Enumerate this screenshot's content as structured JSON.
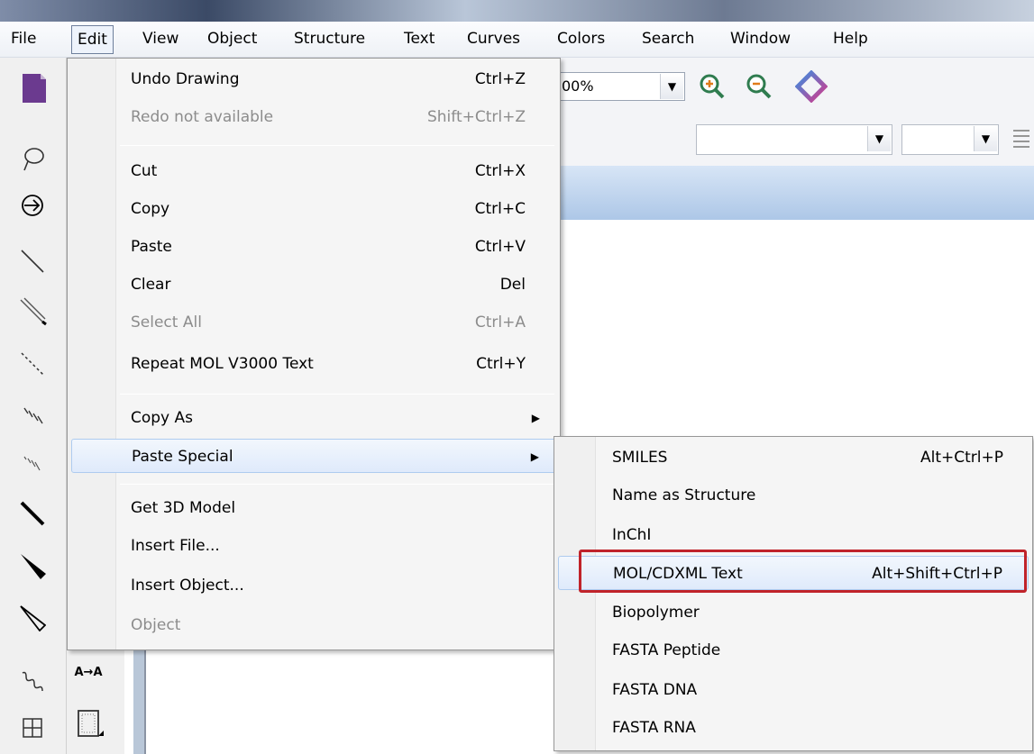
{
  "menubar": {
    "items": [
      "File",
      "Edit",
      "View",
      "Object",
      "Structure",
      "Text",
      "Curves",
      "Colors",
      "Search",
      "Window",
      "Help"
    ],
    "active": "Edit"
  },
  "toolbar": {
    "zoom_value": "00%",
    "zoom_in_icon": "zoom-in-icon",
    "zoom_out_icon": "zoom-out-icon"
  },
  "edit_menu": {
    "items": [
      {
        "label": "Undo Drawing",
        "shortcut": "Ctrl+Z",
        "enabled": true
      },
      {
        "label": "Redo not available",
        "shortcut": "Shift+Ctrl+Z",
        "enabled": false
      },
      {
        "label": "Cut",
        "shortcut": "Ctrl+X",
        "enabled": true
      },
      {
        "label": "Copy",
        "shortcut": "Ctrl+C",
        "enabled": true
      },
      {
        "label": "Paste",
        "shortcut": "Ctrl+V",
        "enabled": true
      },
      {
        "label": "Clear",
        "shortcut": "Del",
        "enabled": true
      },
      {
        "label": "Select All",
        "shortcut": "Ctrl+A",
        "enabled": false
      },
      {
        "label": "Repeat MOL V3000 Text",
        "shortcut": "Ctrl+Y",
        "enabled": true
      },
      {
        "label": "Copy As",
        "shortcut": "",
        "enabled": true,
        "submenu": true
      },
      {
        "label": "Paste Special",
        "shortcut": "",
        "enabled": true,
        "submenu": true,
        "highlighted": true
      },
      {
        "label": "Get 3D Model",
        "shortcut": "",
        "enabled": true
      },
      {
        "label": "Insert File...",
        "shortcut": "",
        "enabled": true
      },
      {
        "label": "Insert Object...",
        "shortcut": "",
        "enabled": true
      },
      {
        "label": "Object",
        "shortcut": "",
        "enabled": false
      }
    ]
  },
  "paste_special_menu": {
    "items": [
      {
        "label": "SMILES",
        "shortcut": "Alt+Ctrl+P"
      },
      {
        "label": "Name as Structure",
        "shortcut": ""
      },
      {
        "label": "InChI",
        "shortcut": ""
      },
      {
        "label": "MOL/CDXML Text",
        "shortcut": "Alt+Shift+Ctrl+P",
        "highlighted": true
      },
      {
        "label": "Biopolymer",
        "shortcut": ""
      },
      {
        "label": "FASTA Peptide",
        "shortcut": ""
      },
      {
        "label": "FASTA DNA",
        "shortcut": ""
      },
      {
        "label": "FASTA RNA",
        "shortcut": ""
      }
    ]
  },
  "tools": {
    "label_tool_text": "A→A"
  },
  "colors": {
    "highlight_border": "#c0232a",
    "menu_highlight": "#dfeafb",
    "document_icon": "#6b3a8f"
  }
}
